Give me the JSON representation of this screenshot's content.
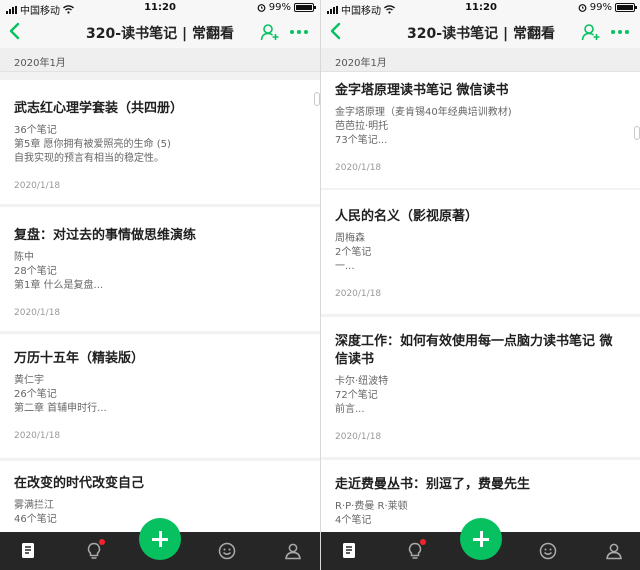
{
  "status_bar": {
    "carrier": "中国移动",
    "time": "11:20",
    "battery": "99%",
    "battery_level": 0.99
  },
  "header": {
    "title": "320-读书笔记 | 常翻看"
  },
  "section_header": "2020年1月",
  "left_list": [
    {
      "title": "武志红心理学套装（共四册）",
      "line1": "36个笔记",
      "line2": "第5章 愿你拥有被爱照亮的生命 (5)",
      "line3": "自我实现的预言有相当的稳定性。",
      "date": "2020/1/18"
    },
    {
      "title": "复盘：对过去的事情做思维演练",
      "line1": "陈中",
      "line2": "28个笔记",
      "line3": "第1章 什么是复盘...",
      "date": "2020/1/18"
    },
    {
      "title": "万历十五年（精装版）",
      "line1": "黄仁宇",
      "line2": "26个笔记",
      "line3": "第二章 首辅申时行...",
      "date": "2020/1/18"
    },
    {
      "title": "在改变的时代改变自己",
      "line1": "雾满拦江",
      "line2": "46个笔记"
    }
  ],
  "right_list": [
    {
      "title": "金字塔原理读书笔记 微信读书",
      "line1": "金字塔原理（麦肯锡40年经典培训教材)",
      "line2": "芭芭拉·明托",
      "line3": "73个笔记...",
      "date": "2020/1/18"
    },
    {
      "title": "人民的名义（影视原著）",
      "line1": "周梅森",
      "line2": "2个笔记",
      "line3": "一...",
      "date": "2020/1/18"
    },
    {
      "title_line1": "深度工作：如何有效使用每一点脑力读书笔记 微",
      "title_line2": "信读书",
      "line1": "卡尔·纽波特",
      "line2": "72个笔记",
      "line3": "前言...",
      "date": "2020/1/18"
    },
    {
      "title": "走近费曼丛书：别逗了，费曼先生",
      "line1": "R·P·费曼 R·莱顿",
      "line2": "4个笔记"
    }
  ],
  "tabbar": {
    "icons": [
      "notes-icon",
      "bulb-icon",
      "add-icon",
      "discover-icon",
      "profile-icon"
    ],
    "accent": "#07c160",
    "badge_color": "#f5222d"
  }
}
